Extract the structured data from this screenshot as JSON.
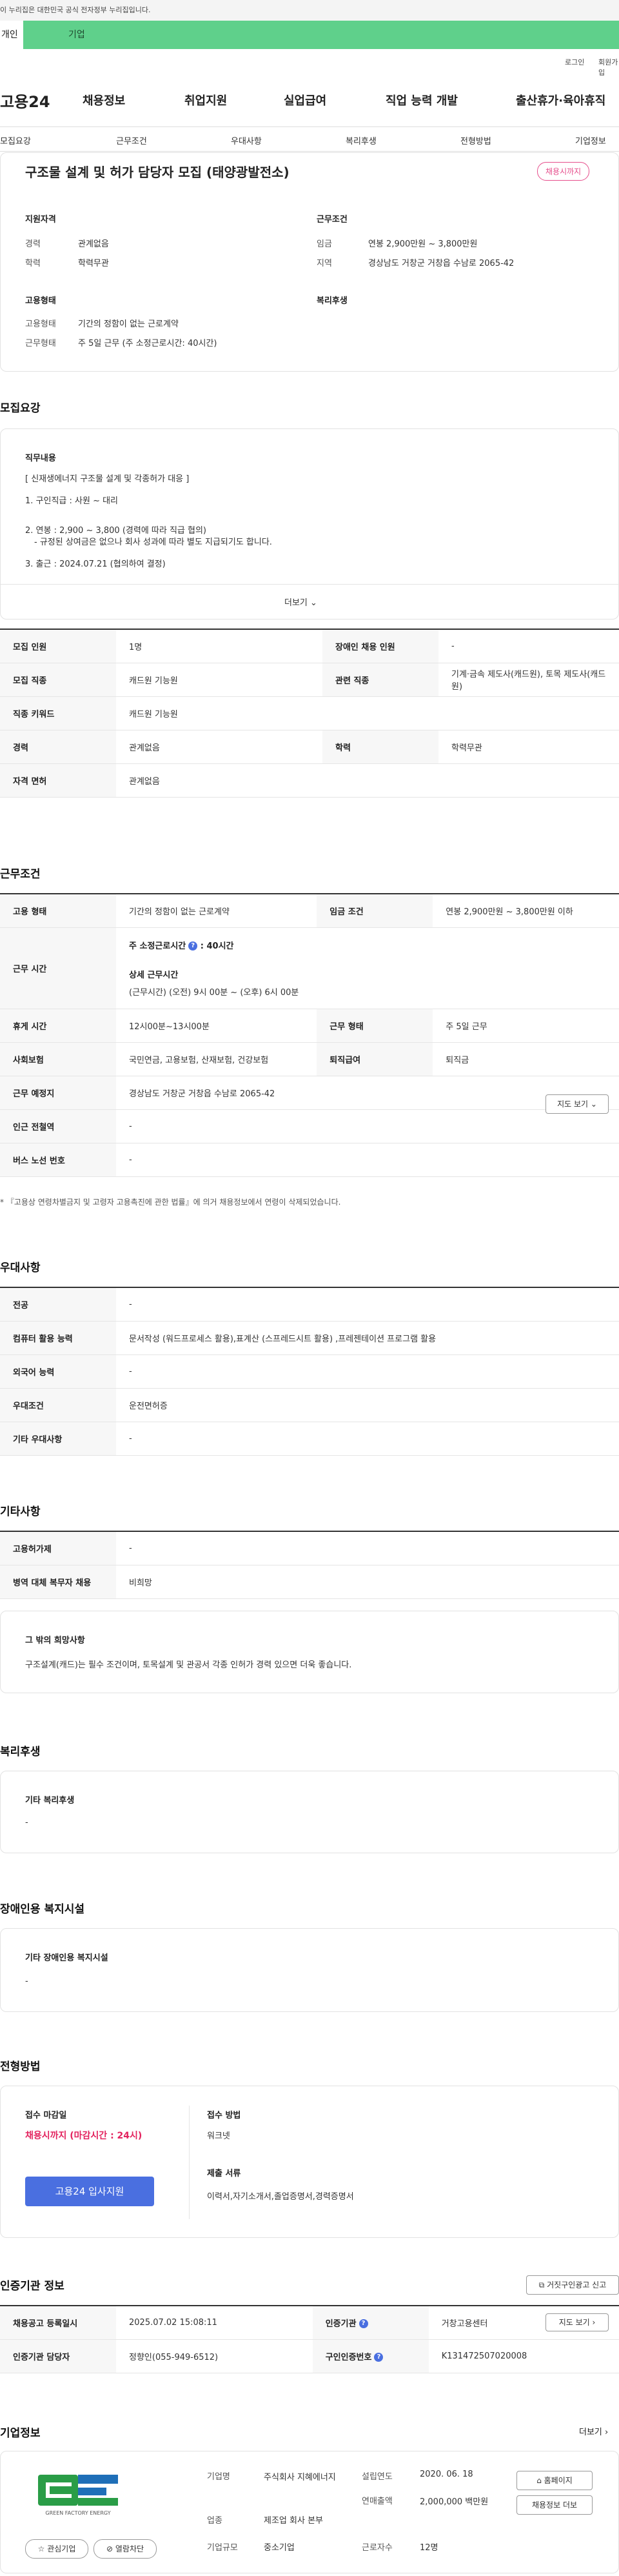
{
  "gov_banner": "이 누리집은 대한민국 공식 전자정부 누리집입니다.",
  "top_tabs": [
    "개인",
    "기업"
  ],
  "util": [
    "로그인",
    "회원가입"
  ],
  "brand": "고용24",
  "gnb": [
    "채용정보",
    "취업지원",
    "실업급여",
    "직업 능력 개발",
    "출산휴가·육아휴직"
  ],
  "lnb": [
    "모집요강",
    "근무조건",
    "우대사항",
    "복리후생",
    "전형방법",
    "기업정보"
  ],
  "job": {
    "title": "구조물 설계 및 허가 담당자 모집 (태양광발전소)",
    "badge": "채용시까지",
    "qual_title": "지원자격",
    "cond_title": "근무조건",
    "emp_title": "고용형태",
    "welfare_title": "복리후생",
    "career_l": "경력",
    "career_v": "관계없음",
    "edu_l": "학력",
    "edu_v": "학력무관",
    "wage_l": "임금",
    "wage_v": "연봉 2,900만원 ~ 3,800만원",
    "area_l": "지역",
    "area_v": "경상남도 거창군 거창읍 수남로 2065-42",
    "etype_l": "고용형태",
    "etype_v": "기간의 정함이 없는 근로계약",
    "wtype_l": "근무형태",
    "wtype_v": "주 5일 근무 (주 소정근로시간: 40시간)"
  },
  "recruit": {
    "title": "모집요강",
    "duty_title": "직무내용",
    "lines": [
      "[ 신재생에너지 구조물 설계 및 각종허가 대응 ]",
      "1. 구인직급 : 사원 ~ 대리",
      "2. 연봉 : 2,900 ~ 3,800 (경력에 따라 직급 협의)",
      "- 규정된 상여금은 없으나 회사 성과에 따라 별도 지급되기도 합니다.",
      "3. 출근 : 2024.07.21 (협의하여 결정)"
    ],
    "more": "더보기",
    "table": [
      [
        "모집 인원",
        "1명",
        "장애인 채용 인원",
        "-"
      ],
      [
        "모집 직종",
        "캐드원 기능원",
        "관련 직종",
        "기계·금속 제도사(캐드원), 토목 제도사(캐드원)"
      ],
      [
        "직종 키워드",
        "캐드원 기능원",
        "",
        ""
      ],
      [
        "경력",
        "관계없음",
        "학력",
        "학력무관"
      ],
      [
        "자격 면허",
        "관계없음",
        "",
        ""
      ]
    ]
  },
  "work": {
    "title": "근무조건",
    "etype_l": "고용 형태",
    "etype_v": "기간의 정함이 없는 근로계약",
    "wage_l": "임금 조건",
    "wage_v": "연봉 2,900만원 ~ 3,800만원 이하",
    "hours_l": "근무 시간",
    "hours_main": "주 소정근로시간",
    "hours_main2": ": 40시간",
    "hours_detail_t": "상세 근무시간",
    "hours_detail": "(근무시간) (오전) 9시 00분 ~ (오후) 6시 00분",
    "rest_l": "휴게 시간",
    "rest_v": "12시00분~13시00분",
    "wform_l": "근무 형태",
    "wform_v": "주 5일 근무",
    "ins_l": "사회보험",
    "ins_v": "국민연금, 고용보험, 산재보험, 건강보험",
    "ret_l": "퇴직급여",
    "ret_v": "퇴직금",
    "place_l": "근무 예정지",
    "place_v": "경상남도 거창군 거창읍 수남로 2065-42",
    "map_btn": "지도 보기",
    "subway_l": "인근 전철역",
    "subway_v": "-",
    "bus_l": "버스 노선 번호",
    "bus_v": "-",
    "note": "* 『고용상 연령차별금지 및 고령자 고용촉진에 관한 법률』에 의거 채용정보에서 연령이 삭제되었습니다."
  },
  "pref": {
    "title": "우대사항",
    "rows": [
      [
        "전공",
        "-"
      ],
      [
        "컴퓨터 활용 능력",
        "문서작성 (워드프로세스 활용),표계산 (스프레드시트 활용) ,프레젠테이션 프로그램 활용"
      ],
      [
        "외국어 능력",
        "-"
      ],
      [
        "우대조건",
        "운전면허증"
      ],
      [
        "기타 우대사항",
        "-"
      ]
    ]
  },
  "etc": {
    "title": "기타사항",
    "rows": [
      [
        "고용허가제",
        "-"
      ],
      [
        "병역 대체 복무자 채용",
        "비희망"
      ]
    ],
    "hope_t": "그 밖의 희망사항",
    "hope_v": "구조설계(캐드)는 필수 조건이며, 토목설계 및 관공서 각종 인허가 경력 있으면 더욱 좋습니다."
  },
  "welfare": {
    "title": "복리후생",
    "sub": "기타 복리후생",
    "v": "-"
  },
  "disab": {
    "title": "장애인용 복지시설",
    "sub": "기타 장애인용 복지시설",
    "v": "-"
  },
  "process": {
    "title": "전형방법",
    "deadline_t": "접수 마감일",
    "deadline_v": "채용시까지 (마감시간 : 24시)",
    "apply_btn": "고용24 입사지원",
    "method_t": "접수 방법",
    "method_v": "워크넷",
    "docs_t": "제출 서류",
    "docs_v": "이력서,자기소개서,졸업증명서,경력증명서"
  },
  "cert": {
    "title": "인증기관 정보",
    "report_btn": "거짓구인광고 신고",
    "reg_l": "채용공고 등록일시",
    "reg_v": "2025.07.02 15:08:11",
    "org_l": "인증기관",
    "org_v": "거창고용센터",
    "map_btn": "지도 보기",
    "mgr_l": "인증기관 담당자",
    "mgr_v": "정향인(055-949-6512)",
    "num_l": "구인인증번호",
    "num_v": "K131472507020008"
  },
  "company": {
    "title": "기업정보",
    "more": "더보기",
    "logo_text": "GREEN FACTORY ENERGY",
    "fav_btn": "관심기업",
    "block_btn": "열람차단",
    "name_l": "기업명",
    "name_v": "주식회사 지혜에너지",
    "found_l": "설립연도",
    "found_v": "2020. 06. 18",
    "ind_l": "업종",
    "ind_v": "제조업 회사 본부",
    "sales_l": "연매출액",
    "sales_v": "2,000,000 백만원",
    "size_l": "기업규모",
    "size_v": "중소기업",
    "emp_l": "근로자수",
    "emp_v": "12명",
    "home_btn": "홈페이지",
    "list_btn": "채용정보 더보"
  },
  "colors": {
    "accent_green": "#5fd08b",
    "accent_blue": "#4a6fe0",
    "accent_pink": "#e64e8c"
  }
}
